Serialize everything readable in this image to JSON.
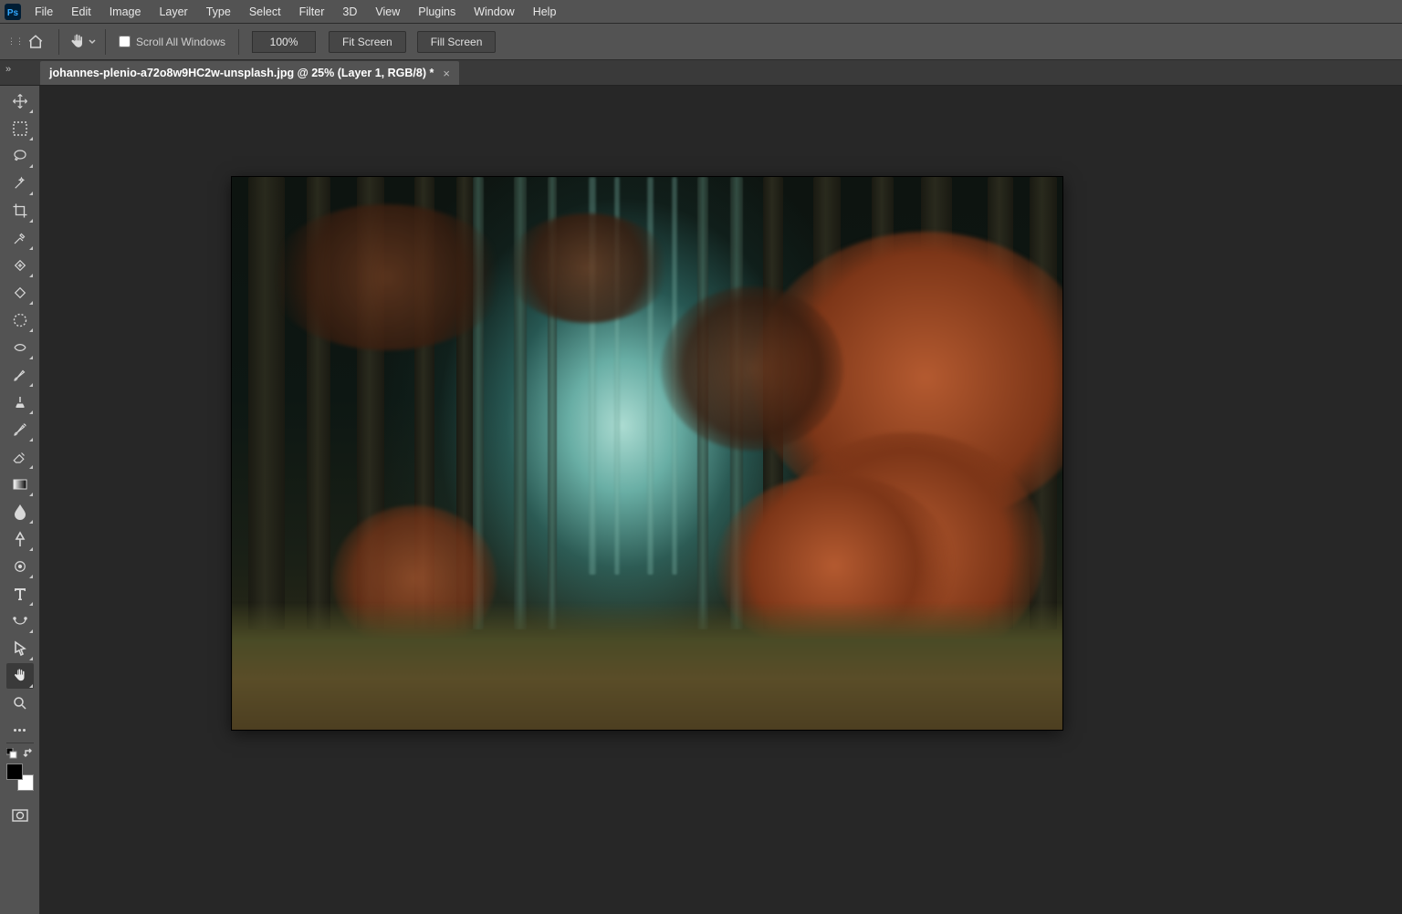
{
  "menu": {
    "items": [
      "File",
      "Edit",
      "Image",
      "Layer",
      "Type",
      "Select",
      "Filter",
      "3D",
      "View",
      "Plugins",
      "Window",
      "Help"
    ]
  },
  "options": {
    "scroll_all_windows": "Scroll All Windows",
    "zoom": "100%",
    "fit_screen": "Fit Screen",
    "fill_screen": "Fill Screen"
  },
  "tab": {
    "title": "johannes-plenio-a72o8w9HC2w-unsplash.jpg @ 25% (Layer 1, RGB/8) *"
  },
  "tools": [
    "move-tool",
    "marquee-tool",
    "lasso-tool",
    "magic-wand-tool",
    "crop-tool",
    "eyedropper-tool",
    "spot-heal-tool",
    "healing-brush-tool",
    "frame-tool",
    "content-aware-tool",
    "brush-tool",
    "clone-stamp-tool",
    "history-brush-tool",
    "eraser-tool",
    "gradient-tool",
    "blur-tool",
    "dodge-tool",
    "pen-tool",
    "type-tool",
    "path-select-tool",
    "direct-select-tool",
    "hand-tool",
    "zoom-tool"
  ],
  "active_tool": "hand-tool",
  "colors": {
    "fg": "#000000",
    "bg": "#ffffff",
    "panel": "#535353",
    "canvas": "#272727"
  }
}
